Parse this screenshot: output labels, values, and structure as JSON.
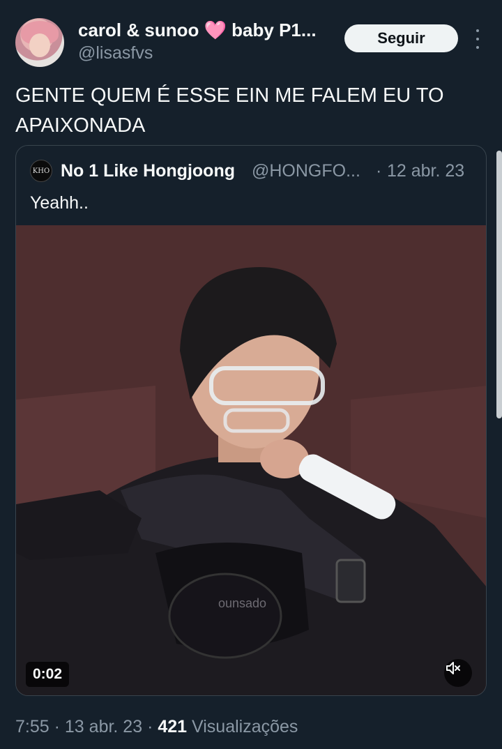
{
  "author": {
    "display_name": "carol & sunoo 🩷 baby P1...",
    "handle": "@lisasfvs",
    "follow_label": "Seguir"
  },
  "tweet": {
    "text": "GENTE QUEM É ESSE EIN ME FALEM EU TO APAIXONADA"
  },
  "quoted": {
    "avatar_text": "KHO",
    "display_name": "No 1 Like Hongjoong",
    "handle": "@HONGFO...",
    "separator": "·",
    "date": "12 abr. 23",
    "text": "Yeahh..",
    "video": {
      "watermark": "ounsado",
      "duration": "0:02",
      "muted": true
    }
  },
  "meta": {
    "time": "7:55",
    "sep1": "·",
    "date": "13 abr. 23",
    "sep2": "·",
    "views_count": "421",
    "views_label": "Visualizações"
  },
  "colors": {
    "background": "#15202b",
    "text": "#f7f9f9",
    "secondary_text": "#8b98a5",
    "border": "#38444d",
    "follow_bg": "#eff3f4"
  }
}
